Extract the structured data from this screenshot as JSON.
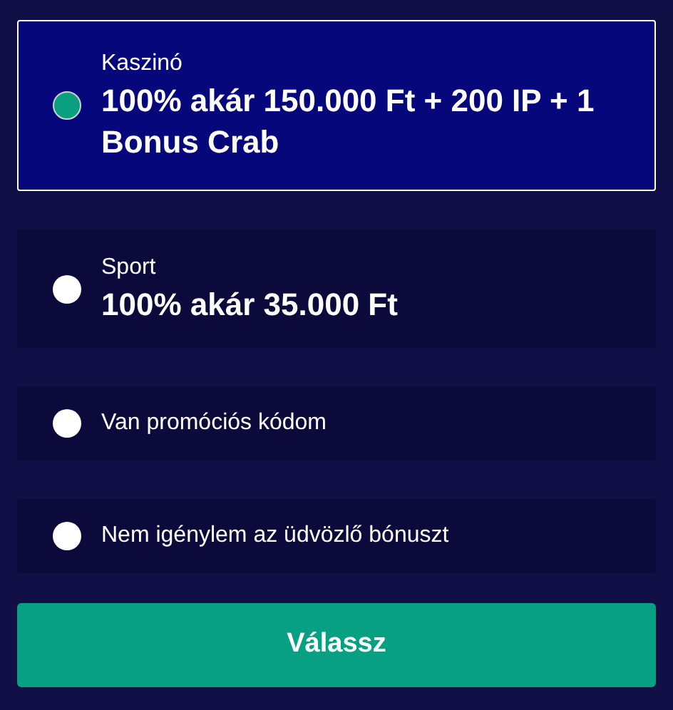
{
  "options": [
    {
      "kind": "offer",
      "category": "Kaszinó",
      "title": "100% akár 150.000 Ft + 200 IP + 1 Bonus Crab",
      "selected": true
    },
    {
      "kind": "offer",
      "category": "Sport",
      "title": "100% akár 35.000 Ft",
      "selected": false
    },
    {
      "kind": "plain",
      "label": "Van promóciós kódom",
      "selected": false
    },
    {
      "kind": "plain",
      "label": "Nem igénylem az üdvözlő bónuszt",
      "selected": false
    }
  ],
  "button": "Válassz"
}
